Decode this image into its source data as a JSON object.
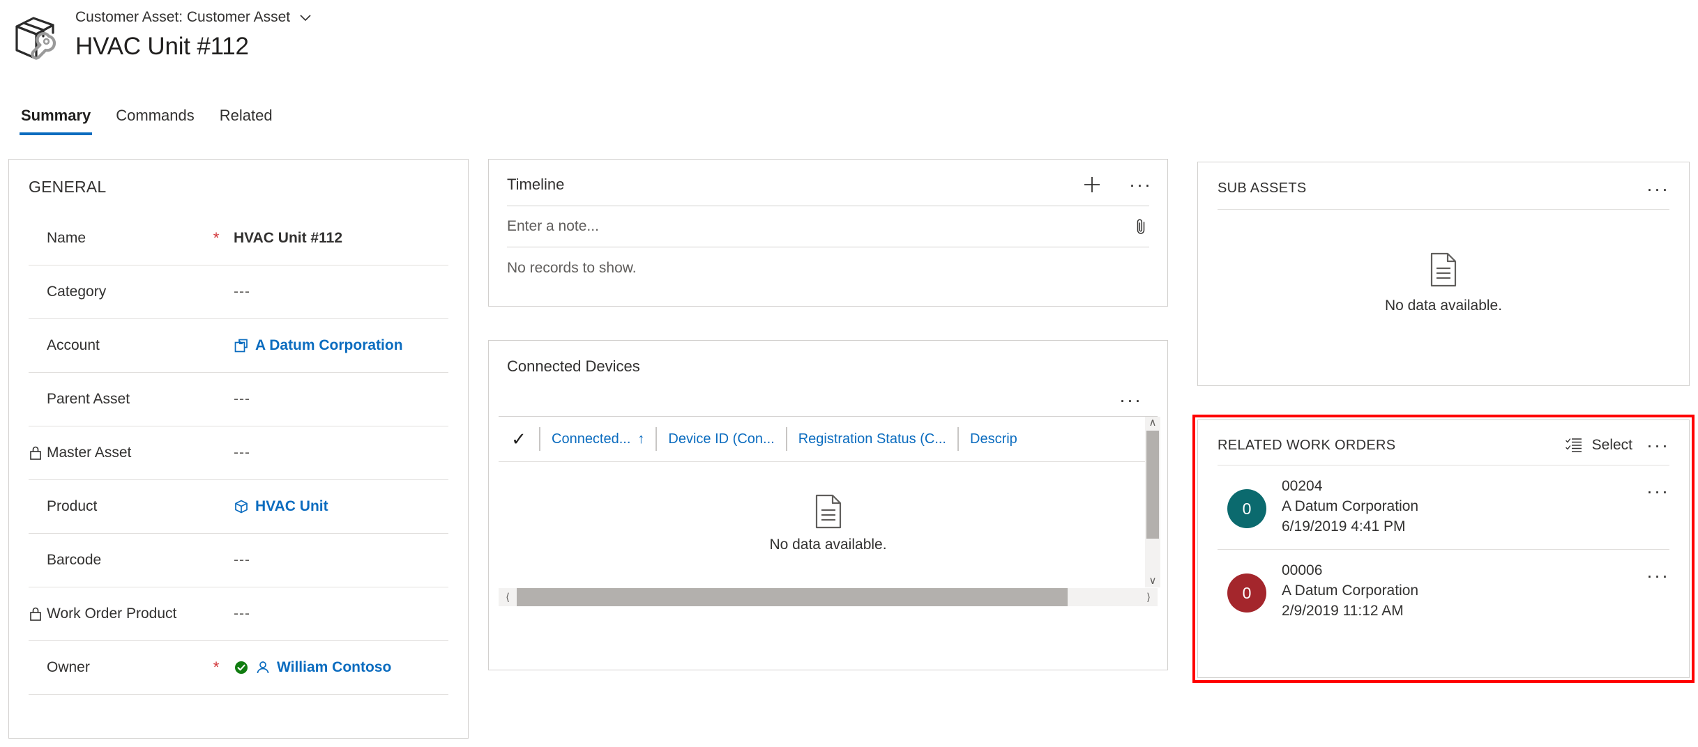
{
  "header": {
    "entity_label": "Customer Asset: Customer Asset",
    "record_title": "HVAC Unit #112",
    "app_icon": "asset-wrench-icon",
    "chevron_icon": "chevron-down-icon"
  },
  "tabs": [
    {
      "label": "Summary",
      "active": true
    },
    {
      "label": "Commands",
      "active": false
    },
    {
      "label": "Related",
      "active": false
    }
  ],
  "general": {
    "title": "GENERAL",
    "fields": [
      {
        "label": "Name",
        "value": "HVAC Unit #112",
        "required": true,
        "locked": false,
        "bold": true,
        "link": false,
        "icon": null
      },
      {
        "label": "Category",
        "value": "---",
        "required": false,
        "locked": false,
        "bold": false,
        "link": false,
        "icon": null
      },
      {
        "label": "Account",
        "value": "A Datum Corporation",
        "required": false,
        "locked": false,
        "bold": true,
        "link": true,
        "icon": "account-entity-icon"
      },
      {
        "label": "Parent Asset",
        "value": "---",
        "required": false,
        "locked": false,
        "bold": false,
        "link": false,
        "icon": null
      },
      {
        "label": "Master Asset",
        "value": "---",
        "required": false,
        "locked": true,
        "bold": false,
        "link": false,
        "icon": null
      },
      {
        "label": "Product",
        "value": "HVAC Unit",
        "required": false,
        "locked": false,
        "bold": true,
        "link": true,
        "icon": "product-box-icon"
      },
      {
        "label": "Barcode",
        "value": "---",
        "required": false,
        "locked": false,
        "bold": false,
        "link": false,
        "icon": null
      },
      {
        "label": "Work Order Product",
        "value": "---",
        "required": false,
        "locked": true,
        "bold": false,
        "link": false,
        "icon": null
      },
      {
        "label": "Owner",
        "value": "William Contoso",
        "required": true,
        "locked": false,
        "bold": true,
        "link": true,
        "icon": "person-icon",
        "status_icon": "green-check-icon"
      }
    ]
  },
  "timeline": {
    "title": "Timeline",
    "add_icon": "plus-icon",
    "more_icon": "ellipsis-icon",
    "note_placeholder": "Enter a note...",
    "note_value": "",
    "attach_icon": "paperclip-icon",
    "empty_text": "No records to show."
  },
  "connected_devices": {
    "title": "Connected Devices",
    "more_icon": "ellipsis-icon",
    "select_all_icon": "checkmark-icon",
    "columns": [
      {
        "label": "Connected...",
        "sorted": true,
        "sort_icon": "sort-ascending-icon"
      },
      {
        "label": "Device ID (Con...",
        "sorted": false,
        "sort_icon": null
      },
      {
        "label": "Registration Status (C...",
        "sorted": false,
        "sort_icon": null
      },
      {
        "label": "Descrip",
        "sorted": false,
        "sort_icon": null
      }
    ],
    "rows": [],
    "empty_icon": "document-empty-icon",
    "empty_text": "No data available.",
    "scroll_up_icon": "chevron-up-icon",
    "scroll_down_icon": "chevron-down-icon",
    "scroll_left_icon": "chevron-left-icon",
    "scroll_right_icon": "chevron-right-icon"
  },
  "sub_assets": {
    "title": "SUB ASSETS",
    "more_icon": "ellipsis-icon",
    "empty_icon": "document-empty-icon",
    "empty_text": "No data available."
  },
  "related_work_orders": {
    "title": "RELATED WORK ORDERS",
    "select_label": "Select",
    "select_icon": "select-list-icon",
    "more_icon": "ellipsis-icon",
    "highlight_color": "#ff0000",
    "items": [
      {
        "badge_value": "0",
        "badge_color": "#0b6a6e",
        "number": "00204",
        "account": "A Datum Corporation",
        "date": "6/19/2019 4:41 PM",
        "more_icon": "ellipsis-icon"
      },
      {
        "badge_value": "0",
        "badge_color": "#a4262c",
        "number": "00006",
        "account": "A Datum Corporation",
        "date": "2/9/2019 11:12 AM",
        "more_icon": "ellipsis-icon"
      }
    ]
  },
  "colors": {
    "accent": "#0b6cbf",
    "required_star": "#d13438",
    "success": "#107c10",
    "border": "#d2d0ce"
  }
}
